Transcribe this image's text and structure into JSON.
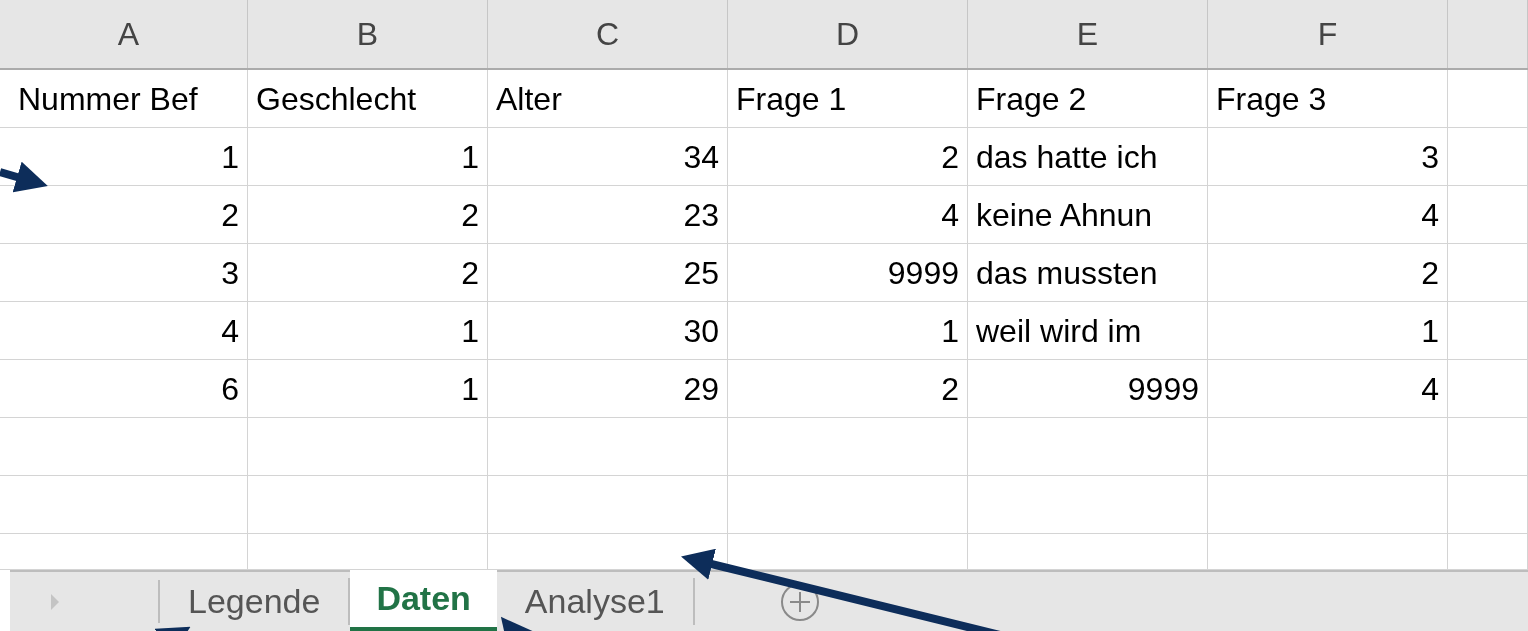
{
  "columns": [
    "A",
    "B",
    "C",
    "D",
    "E",
    "F"
  ],
  "rows": [
    [
      {
        "text": "Nummer Bef",
        "kind": "text"
      },
      {
        "text": "Geschlecht",
        "kind": "text"
      },
      {
        "text": "Alter",
        "kind": "text"
      },
      {
        "text": "Frage 1",
        "kind": "text"
      },
      {
        "text": "Frage 2",
        "kind": "text"
      },
      {
        "text": "Frage 3",
        "kind": "text"
      }
    ],
    [
      {
        "text": "1",
        "kind": "number"
      },
      {
        "text": "1",
        "kind": "number"
      },
      {
        "text": "34",
        "kind": "number"
      },
      {
        "text": "2",
        "kind": "number"
      },
      {
        "text": "das hatte ich",
        "kind": "text"
      },
      {
        "text": "3",
        "kind": "number"
      }
    ],
    [
      {
        "text": "2",
        "kind": "number"
      },
      {
        "text": "2",
        "kind": "number"
      },
      {
        "text": "23",
        "kind": "number"
      },
      {
        "text": "4",
        "kind": "number"
      },
      {
        "text": "keine Ahnun",
        "kind": "text"
      },
      {
        "text": "4",
        "kind": "number"
      }
    ],
    [
      {
        "text": "3",
        "kind": "number"
      },
      {
        "text": "2",
        "kind": "number"
      },
      {
        "text": "25",
        "kind": "number"
      },
      {
        "text": "9999",
        "kind": "number"
      },
      {
        "text": "das mussten",
        "kind": "text"
      },
      {
        "text": "2",
        "kind": "number"
      }
    ],
    [
      {
        "text": "4",
        "kind": "number"
      },
      {
        "text": "1",
        "kind": "number"
      },
      {
        "text": "30",
        "kind": "number"
      },
      {
        "text": "1",
        "kind": "number"
      },
      {
        "text": "weil wird im",
        "kind": "text"
      },
      {
        "text": "1",
        "kind": "number"
      }
    ],
    [
      {
        "text": "6",
        "kind": "number"
      },
      {
        "text": "1",
        "kind": "number"
      },
      {
        "text": "29",
        "kind": "number"
      },
      {
        "text": "2",
        "kind": "number"
      },
      {
        "text": "9999",
        "kind": "number"
      },
      {
        "text": "4",
        "kind": "number"
      }
    ]
  ],
  "sheet_tabs": [
    {
      "label": "Legende",
      "selected": false
    },
    {
      "label": "Daten",
      "selected": true
    },
    {
      "label": "Analyse1",
      "selected": false
    }
  ]
}
